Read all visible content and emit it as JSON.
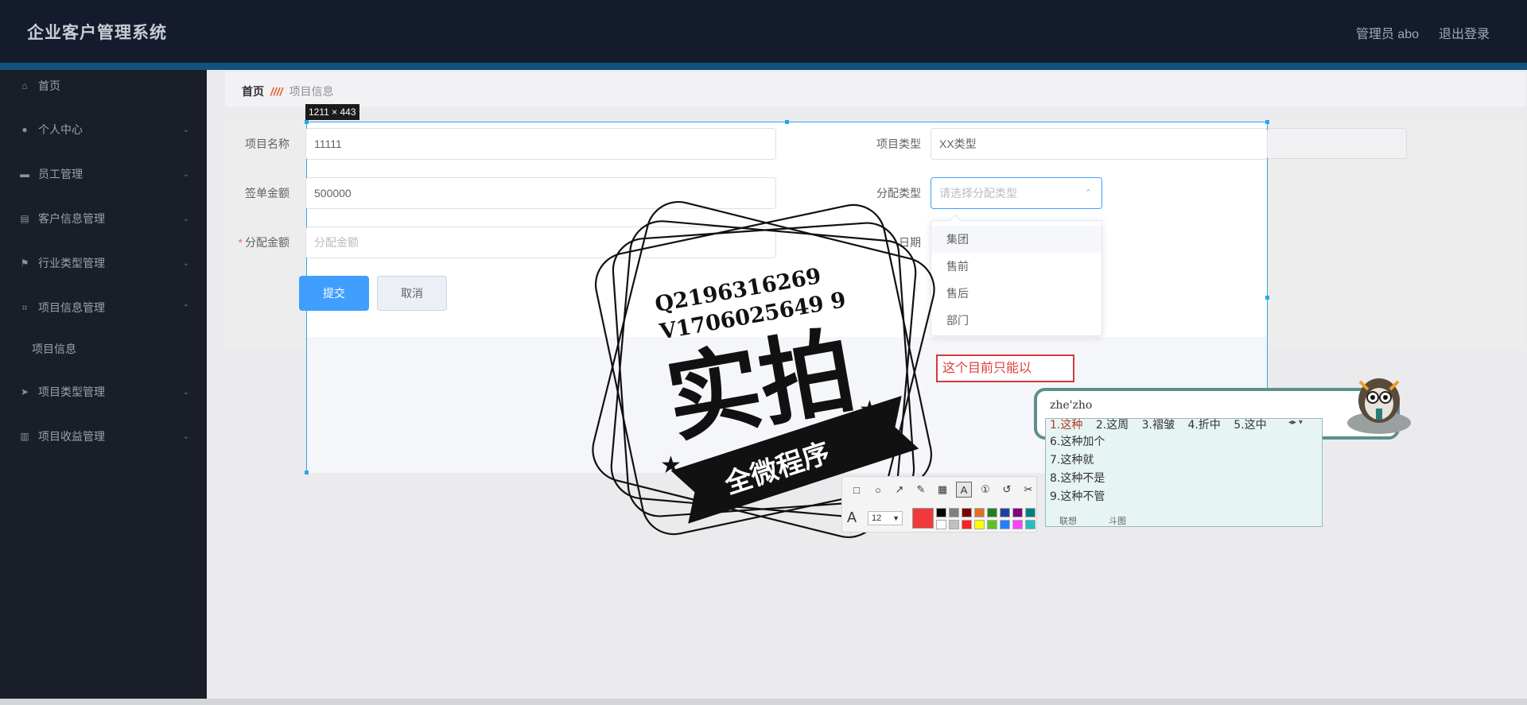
{
  "app": {
    "title": "企业客户管理系统",
    "user": "管理员 abo",
    "logout": "退出登录"
  },
  "sidebar": {
    "items": [
      {
        "label": "首页",
        "icon": "home-icon"
      },
      {
        "label": "个人中心",
        "icon": "user-icon"
      },
      {
        "label": "员工管理",
        "icon": "monitor-icon"
      },
      {
        "label": "客户信息管理",
        "icon": "clipboard-icon"
      },
      {
        "label": "行业类型管理",
        "icon": "flag-icon"
      },
      {
        "label": "项目信息管理",
        "icon": "frame-icon"
      },
      {
        "label": "项目信息",
        "icon": ""
      },
      {
        "label": "项目类型管理",
        "icon": "send-icon"
      },
      {
        "label": "项目收益管理",
        "icon": "chart-icon"
      }
    ]
  },
  "breadcrumb": {
    "home": "首页",
    "sep": "////",
    "current": "项目信息"
  },
  "capture": {
    "size_label": "1211 × 443",
    "accent_color": "#2aa7e8"
  },
  "form": {
    "project_name_label": "项目名称",
    "project_name_value": "11111",
    "project_type_label": "项目类型",
    "project_type_value": "XX类型",
    "sign_amount_label": "签单金额",
    "sign_amount_value": "500000",
    "alloc_type_label": "分配类型",
    "alloc_type_placeholder": "请选择分配类型",
    "alloc_amount_label": "分配金额",
    "alloc_amount_placeholder": "分配金额",
    "date_label": "日期",
    "submit": "提交",
    "cancel": "取消"
  },
  "dropdown": {
    "options": [
      "集团",
      "售前",
      "售后",
      "部门"
    ]
  },
  "annotation": {
    "text": "这个目前只能以",
    "color": "#d33a3a"
  },
  "stamp": {
    "line1": "Q2196316269",
    "line2": "V1706025649 9",
    "main": "实拍",
    "ribbon": "全微程序"
  },
  "toolbar": {
    "tools": [
      "rect-icon",
      "ellipse-icon",
      "arrow-icon",
      "pen-icon",
      "mosaic-icon",
      "text-icon",
      "number-icon",
      "undo-icon",
      "cut-icon"
    ],
    "font_size": "12",
    "current_color": "#f03a3a",
    "palette": [
      "#000000",
      "#808080",
      "#800000",
      "#e07020",
      "#208020",
      "#2040a0",
      "#800080",
      "#008080",
      "#ffffff",
      "#c0c0c0",
      "#ff2020",
      "#ffff00",
      "#60c020",
      "#2080ff",
      "#ff40ff",
      "#20c0c0"
    ]
  },
  "ime": {
    "pinyin": "zhe'zho",
    "row1": [
      "1.这种",
      "2.这周",
      "3.褶皱",
      "4.折中",
      "5.这中"
    ],
    "list": [
      "6.这种加个",
      "7.这种就",
      "8.这种不是",
      "9.这种不管"
    ],
    "tab1": "联想",
    "tab2": "斗图"
  }
}
